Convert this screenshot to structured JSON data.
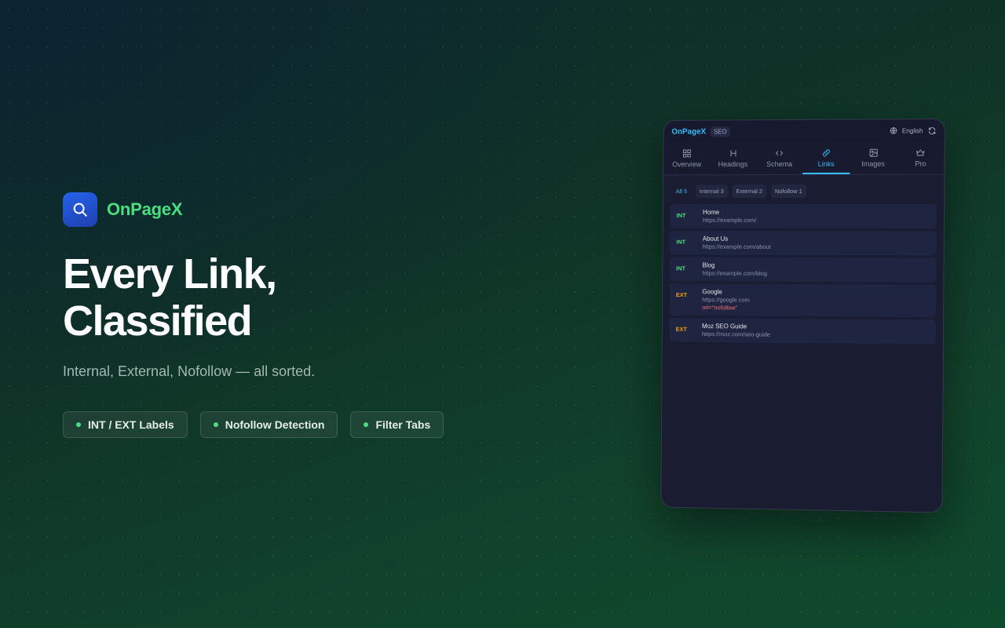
{
  "brand": {
    "name": "OnPageX",
    "icon": "search-icon"
  },
  "hero": {
    "headline_line1": "Every Link,",
    "headline_line2": "Classified",
    "subline": "Internal, External, Nofollow — all sorted."
  },
  "features": [
    {
      "label": "INT / EXT Labels"
    },
    {
      "label": "Nofollow Detection"
    },
    {
      "label": "Filter Tabs"
    }
  ],
  "panel": {
    "logo": "OnPageX",
    "badge": "SEO",
    "language": "English",
    "tabs": [
      {
        "label": "Overview",
        "icon": "grid-icon"
      },
      {
        "label": "Headings",
        "icon": "heading-icon"
      },
      {
        "label": "Schema",
        "icon": "code-icon"
      },
      {
        "label": "Links",
        "icon": "link-icon",
        "active": true
      },
      {
        "label": "Images",
        "icon": "image-icon"
      },
      {
        "label": "Pro",
        "icon": "crown-icon"
      }
    ],
    "filters": [
      {
        "label": "All 5",
        "active": true
      },
      {
        "label": "Internal 3"
      },
      {
        "label": "External 2"
      },
      {
        "label": "Nofollow 1"
      }
    ],
    "links": [
      {
        "type": "INT",
        "title": "Home",
        "url": "https://example.com/",
        "rel": ""
      },
      {
        "type": "INT",
        "title": "About Us",
        "url": "https://example.com/about",
        "rel": ""
      },
      {
        "type": "INT",
        "title": "Blog",
        "url": "https://example.com/blog",
        "rel": ""
      },
      {
        "type": "EXT",
        "title": "Google",
        "url": "https://google.com",
        "rel": "rel=\"nofollow\""
      },
      {
        "type": "EXT",
        "title": "Moz SEO Guide",
        "url": "https://moz.com/seo-guide",
        "rel": ""
      }
    ]
  },
  "colors": {
    "accent_green": "#4ade80",
    "accent_blue": "#38bdf8",
    "ext_orange": "#f59e0b",
    "nofollow_red": "#f87171"
  }
}
